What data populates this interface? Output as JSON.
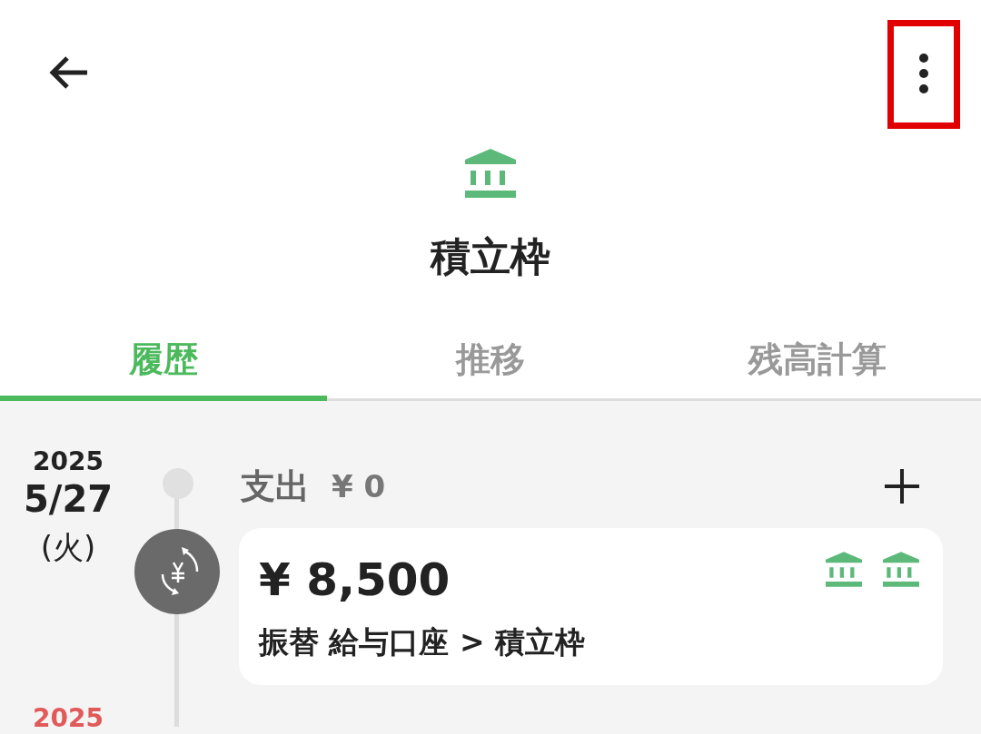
{
  "header": {
    "menu_highlighted": true
  },
  "account": {
    "kind": "bank",
    "title": "積立枠"
  },
  "tabs": [
    {
      "label": "履歴",
      "selected": true
    },
    {
      "label": "推移",
      "selected": false
    },
    {
      "label": "残高計算",
      "selected": false
    }
  ],
  "entries": [
    {
      "year": "2025",
      "date": "5/27",
      "weekday": "(火)",
      "color": "#222222",
      "expense_label": "支出",
      "expense_amount": "¥ 0",
      "transactions": [
        {
          "kind": "transfer",
          "amount": "¥ 8,500",
          "description": "振替 給与口座 > 積立枠",
          "accounts": [
            {
              "kind": "bank"
            },
            {
              "kind": "bank"
            }
          ]
        }
      ]
    },
    {
      "year": "2025",
      "color": "#e05a5a"
    }
  ]
}
